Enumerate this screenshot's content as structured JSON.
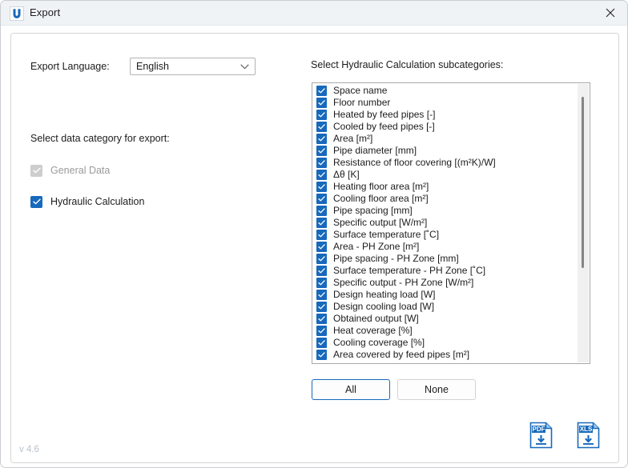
{
  "window": {
    "title": "Export",
    "logo_icon": "u-logo-icon",
    "close_icon": "close-icon",
    "version": "v 4.6"
  },
  "left_panel": {
    "language_label": "Export Language:",
    "language_value": "English",
    "language_chevron_icon": "chevron-down-icon",
    "category_label": "Select data category for export:",
    "categories": [
      {
        "label": "General Data",
        "checked": true,
        "disabled": true
      },
      {
        "label": "Hydraulic Calculation",
        "checked": true,
        "disabled": false
      }
    ]
  },
  "right_panel": {
    "subcategories_label": "Select Hydraulic Calculation subcategories:",
    "items": [
      "Space name",
      "Floor number",
      "Heated by feed pipes [-]",
      "Cooled by feed pipes [-]",
      "Area [m²]",
      "Pipe diameter [mm]",
      "Resistance of floor covering [(m²K)/W]",
      "Δθ [K]",
      "Heating floor area [m²]",
      "Cooling floor area [m²]",
      "Pipe spacing [mm]",
      "Specific output [W/m²]",
      "Surface temperature [˚C]",
      "Area - PH Zone [m²]",
      "Pipe spacing - PH Zone [mm]",
      "Surface temperature - PH Zone [˚C]",
      "Specific output - PH Zone [W/m²]",
      "Design heating load [W]",
      "Design cooling load [W]",
      "Obtained output [W]",
      "Heat coverage [%]",
      "Cooling coverage [%]",
      "Area covered by feed pipes [m²]"
    ],
    "select_all_label": "All",
    "select_none_label": "None"
  },
  "export_buttons": [
    {
      "label": "PDF",
      "icon": "pdf-download-icon"
    },
    {
      "label": "XLS",
      "icon": "xls-download-icon"
    }
  ],
  "colors": {
    "accent": "#1769bc",
    "titlebar": "#f0f3f6",
    "disabled_checkbox": "#cdcdcd",
    "version_text": "#b9c2cc"
  }
}
